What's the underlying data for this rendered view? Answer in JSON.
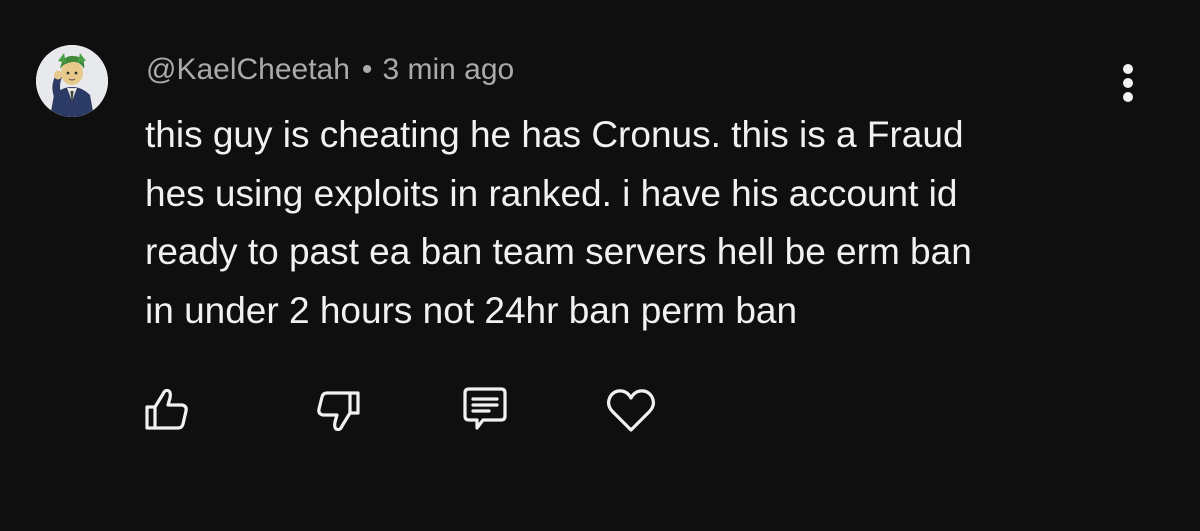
{
  "comment": {
    "author": "@KaelCheetah",
    "separator": "•",
    "timestamp": "3 min ago",
    "text_lines": [
      "this guy is cheating he has Cronus. this is a Fraud",
      "hes using exploits in ranked. i have his account id",
      "ready to past ea ban team servers hell be erm ban",
      "in under 2 hours not 24hr ban perm ban"
    ]
  },
  "actions": [
    {
      "icon": "thumbs-up-icon"
    },
    {
      "icon": "thumbs-down-icon"
    },
    {
      "icon": "reply-comment-icon"
    },
    {
      "icon": "heart-icon"
    }
  ],
  "menu": {
    "icon": "more-vertical-icon"
  },
  "colors": {
    "background": "#0f0f0f",
    "primary_text": "#f1f1f1",
    "secondary_text": "#aaaaaa"
  }
}
